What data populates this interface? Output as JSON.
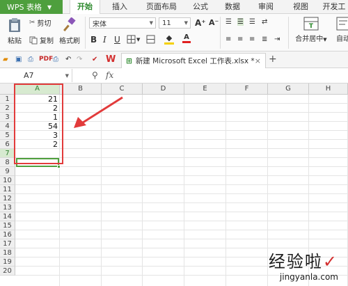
{
  "app": {
    "name": "WPS 表格"
  },
  "menu": {
    "tabs": [
      {
        "label": "开始"
      },
      {
        "label": "插入"
      },
      {
        "label": "页面布局"
      },
      {
        "label": "公式"
      },
      {
        "label": "数据"
      },
      {
        "label": "审阅"
      },
      {
        "label": "视图"
      },
      {
        "label": "开发工"
      }
    ]
  },
  "ribbon": {
    "paste": "粘贴",
    "cut": "剪切",
    "copy": "复制",
    "format_painter": "格式刷",
    "font_name": "宋体",
    "font_size": "11",
    "merge_center": "合并居中",
    "auto_wrap": "自动"
  },
  "doc": {
    "tab_title": "新建 Microsoft Excel 工作表.xlsx *",
    "add_tab": "+"
  },
  "formula_bar": {
    "name_box": "A7",
    "fx": "fx",
    "value": ""
  },
  "sheet": {
    "columns": [
      "A",
      "B",
      "C",
      "D",
      "E",
      "F",
      "G",
      "H"
    ],
    "rows": [
      "1",
      "2",
      "3",
      "4",
      "5",
      "6",
      "7",
      "8",
      "9",
      "10",
      "11",
      "12",
      "13",
      "14",
      "15",
      "16",
      "17",
      "18",
      "19",
      "20"
    ],
    "column_a_values": [
      "21",
      "2",
      "1",
      "54",
      "3",
      "2"
    ],
    "selected_cell": "A7"
  },
  "watermark": {
    "main": "经验啦",
    "check": "✓",
    "sub": "jingyanla.com"
  },
  "colors": {
    "accent": "#4e9f3d",
    "annotation": "#e23b3b"
  }
}
